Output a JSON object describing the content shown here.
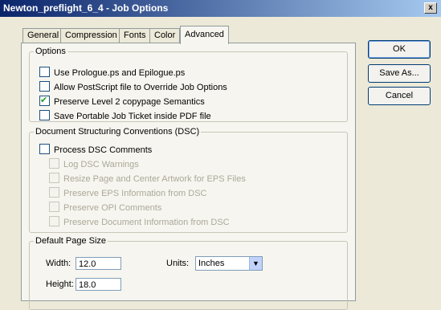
{
  "window": {
    "title": "Newton_preflight_6_4 - Job Options",
    "close_symbol": "x"
  },
  "tabs": [
    {
      "label": "General",
      "active": false
    },
    {
      "label": "Compression",
      "active": false
    },
    {
      "label": "Fonts",
      "active": false
    },
    {
      "label": "Color",
      "active": false
    },
    {
      "label": "Advanced",
      "active": true
    }
  ],
  "options": {
    "legend": "Options",
    "items": [
      {
        "label": "Use Prologue.ps and Epilogue.ps",
        "checked": false
      },
      {
        "label": "Allow PostScript file to Override Job Options",
        "checked": false
      },
      {
        "label": "Preserve Level 2 copypage Semantics",
        "checked": true
      },
      {
        "label": "Save Portable Job Ticket inside PDF file",
        "checked": false
      }
    ]
  },
  "dsc": {
    "legend": "Document Structuring Conventions (DSC)",
    "process": {
      "label": "Process DSC Comments",
      "checked": false
    },
    "items": [
      {
        "label": "Log DSC Warnings",
        "checked": false,
        "enabled": false
      },
      {
        "label": "Resize Page and Center Artwork for EPS Files",
        "checked": false,
        "enabled": false
      },
      {
        "label": "Preserve EPS Information from DSC",
        "checked": false,
        "enabled": false
      },
      {
        "label": "Preserve OPI Comments",
        "checked": false,
        "enabled": false
      },
      {
        "label": "Preserve Document Information from DSC",
        "checked": false,
        "enabled": false
      }
    ]
  },
  "page_size": {
    "legend": "Default Page Size",
    "width_label": "Width:",
    "width_value": "12.0",
    "height_label": "Height:",
    "height_value": "18.0",
    "units_label": "Units:",
    "units_value": "Inches"
  },
  "buttons": {
    "ok": "OK",
    "save_as": "Save As...",
    "cancel": "Cancel"
  }
}
